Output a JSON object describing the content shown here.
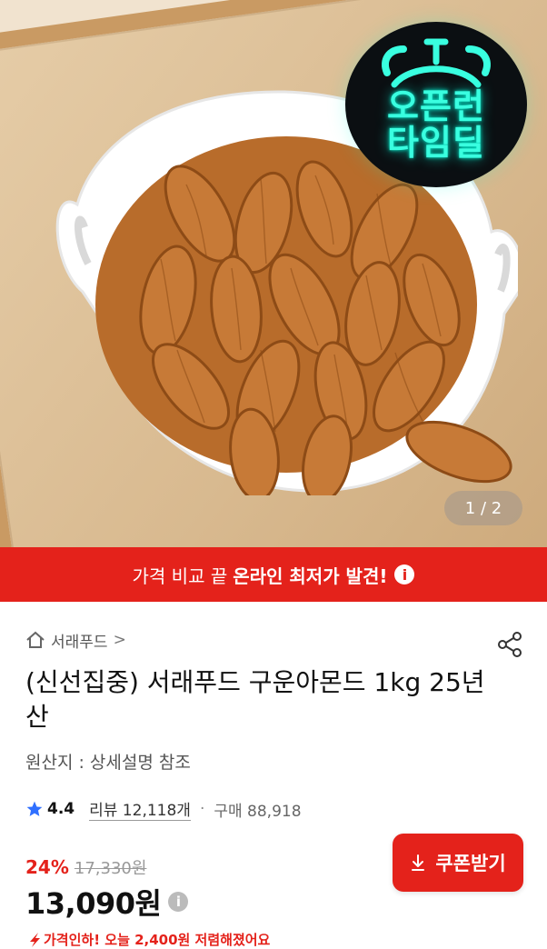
{
  "hero": {
    "badge_line1": "오픈런",
    "badge_line2": "타임딜",
    "page_indicator": "1 / 2"
  },
  "promo": {
    "prefix": "가격 비교 끝",
    "emphasis": "온라인 최저가 발견!",
    "info_icon": "i"
  },
  "breadcrumb": {
    "brand": "서래푸드",
    "chevron": ">"
  },
  "product": {
    "title": "(신선집중) 서래푸드 구운아몬드 1kg 25년산",
    "origin": "원산지 : 상세설명 참조",
    "rating": "4.4",
    "review": "리뷰 12,118개",
    "dot": "·",
    "purchases": "구매 88,918",
    "discount": "24%",
    "original_price": "17,330원",
    "price": "13,090원",
    "price_info": "i",
    "price_drop": "가격인하! 오늘 2,400원 저렴해졌어요"
  },
  "actions": {
    "coupon_label": "쿠폰받기"
  },
  "colors": {
    "accent": "#e4221b",
    "badge_neon": "#39ffe0",
    "star": "#2f6fff"
  },
  "icons": {
    "home": "home-icon",
    "share": "share-icon",
    "star": "star-icon",
    "down_arrow": "download-arrow-icon",
    "drop": "price-drop-arrow-icon"
  }
}
